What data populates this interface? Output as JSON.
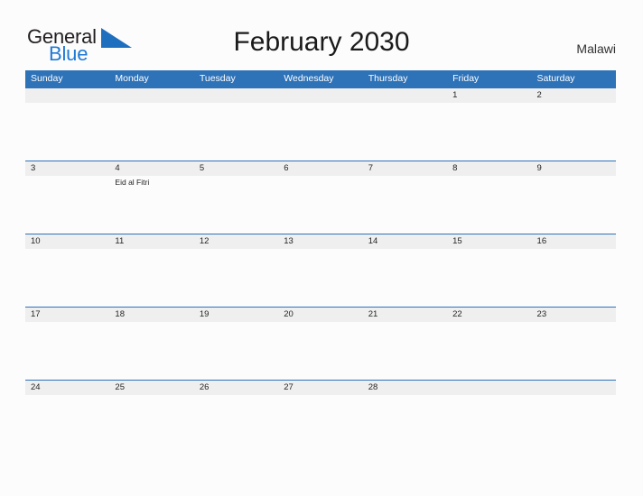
{
  "brand": {
    "name_part1": "General",
    "name_part2": "Blue",
    "flag_icon": "blue-triangle-flag-icon",
    "accent_color": "#1f7ad4"
  },
  "header": {
    "title": "February 2030",
    "country": "Malawi"
  },
  "calendar": {
    "month": "February",
    "year": "2030",
    "header_bg_color": "#2e72b8",
    "row_band_color": "#efefef",
    "weekdays": [
      "Sunday",
      "Monday",
      "Tuesday",
      "Wednesday",
      "Thursday",
      "Friday",
      "Saturday"
    ],
    "weeks": [
      [
        {
          "day": "",
          "event": ""
        },
        {
          "day": "",
          "event": ""
        },
        {
          "day": "",
          "event": ""
        },
        {
          "day": "",
          "event": ""
        },
        {
          "day": "",
          "event": ""
        },
        {
          "day": "1",
          "event": ""
        },
        {
          "day": "2",
          "event": ""
        }
      ],
      [
        {
          "day": "3",
          "event": ""
        },
        {
          "day": "4",
          "event": "Eid al Fitri"
        },
        {
          "day": "5",
          "event": ""
        },
        {
          "day": "6",
          "event": ""
        },
        {
          "day": "7",
          "event": ""
        },
        {
          "day": "8",
          "event": ""
        },
        {
          "day": "9",
          "event": ""
        }
      ],
      [
        {
          "day": "10",
          "event": ""
        },
        {
          "day": "11",
          "event": ""
        },
        {
          "day": "12",
          "event": ""
        },
        {
          "day": "13",
          "event": ""
        },
        {
          "day": "14",
          "event": ""
        },
        {
          "day": "15",
          "event": ""
        },
        {
          "day": "16",
          "event": ""
        }
      ],
      [
        {
          "day": "17",
          "event": ""
        },
        {
          "day": "18",
          "event": ""
        },
        {
          "day": "19",
          "event": ""
        },
        {
          "day": "20",
          "event": ""
        },
        {
          "day": "21",
          "event": ""
        },
        {
          "day": "22",
          "event": ""
        },
        {
          "day": "23",
          "event": ""
        }
      ],
      [
        {
          "day": "24",
          "event": ""
        },
        {
          "day": "25",
          "event": ""
        },
        {
          "day": "26",
          "event": ""
        },
        {
          "day": "27",
          "event": ""
        },
        {
          "day": "28",
          "event": ""
        },
        {
          "day": "",
          "event": ""
        },
        {
          "day": "",
          "event": ""
        }
      ]
    ]
  }
}
